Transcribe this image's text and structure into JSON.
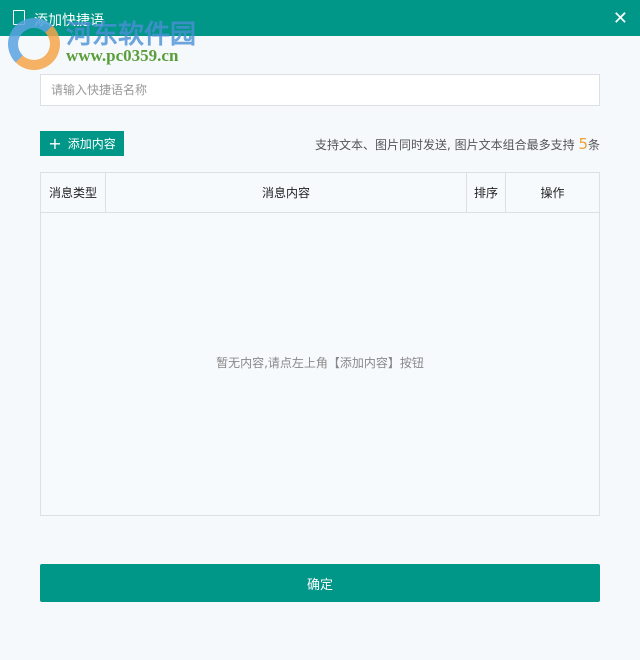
{
  "window": {
    "title": "添加快捷语",
    "close_icon": "close-icon"
  },
  "watermark": {
    "name": "河东软件园",
    "url": "www.pc0359.cn"
  },
  "form": {
    "name_placeholder": "请输入快捷语名称",
    "name_value": ""
  },
  "toolbar": {
    "add_label": "添加内容",
    "hint_text": "支持文本、图片同时发送, 图片文本组合最多支持 ",
    "hint_count": "5",
    "hint_suffix": "条"
  },
  "table": {
    "columns": [
      "消息类型",
      "消息内容",
      "排序",
      "操作"
    ],
    "rows": [],
    "empty_text": "暂无内容,请点左上角【添加内容】按钮"
  },
  "footer": {
    "confirm_label": "确定"
  },
  "colors": {
    "accent": "#009688",
    "highlight": "#f0a030"
  }
}
